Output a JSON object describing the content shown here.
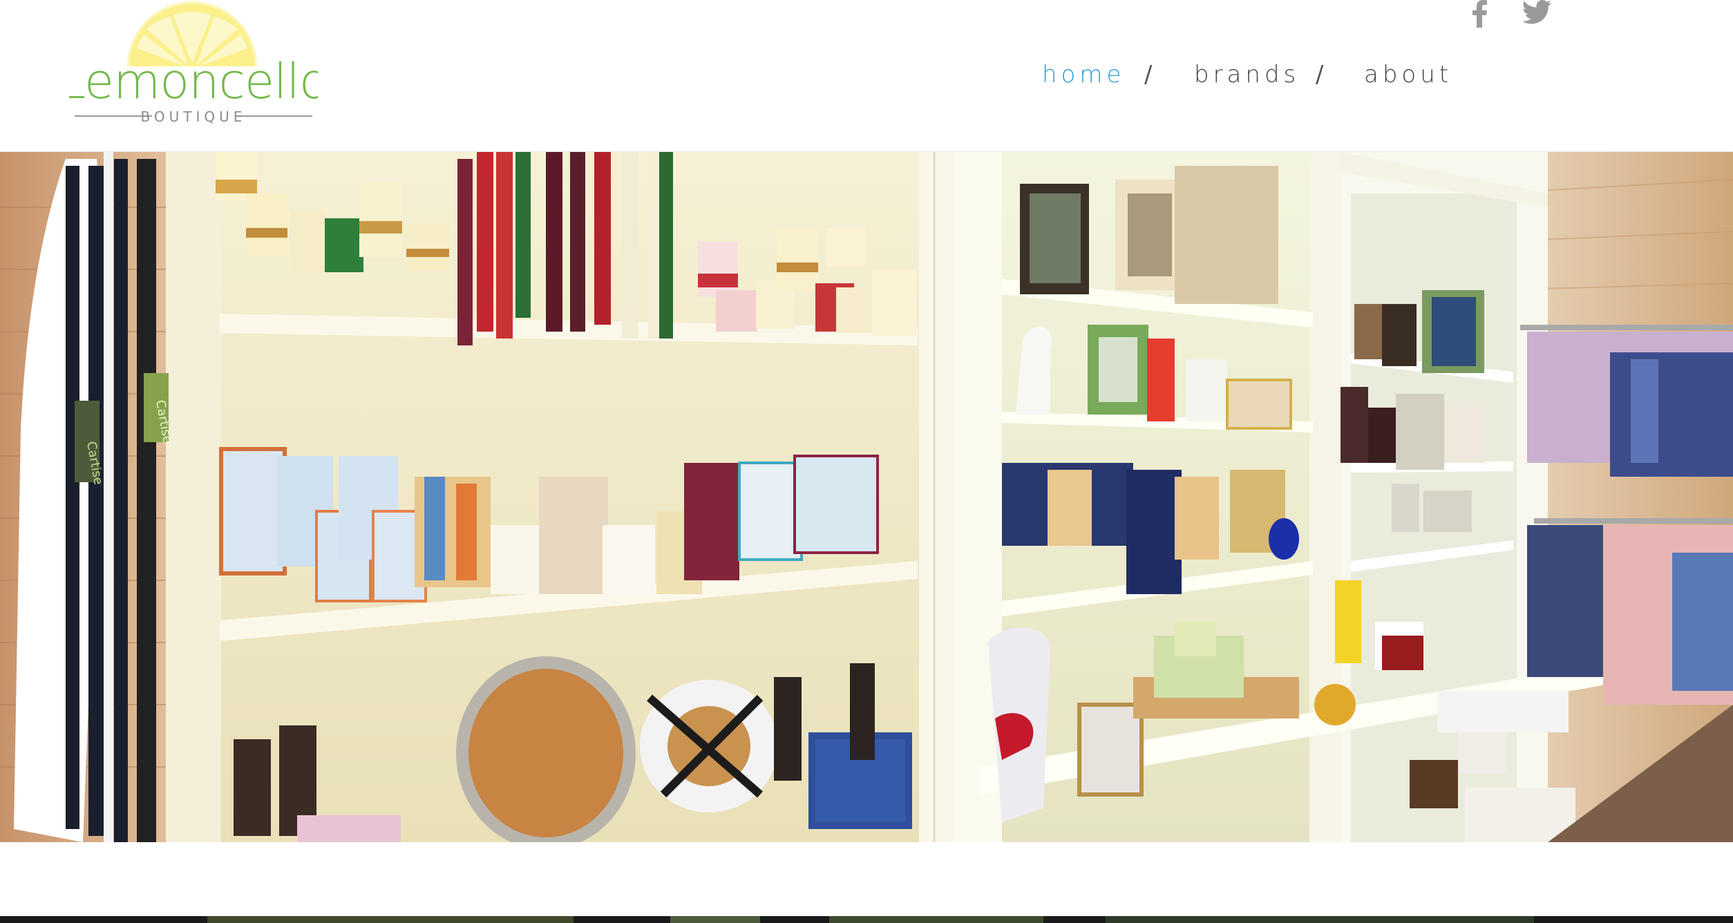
{
  "brand": {
    "name": "Lemoncello",
    "tagline": "BOUTIQUE",
    "colors": {
      "lemon": "#fbf08a",
      "green": "#74b84a",
      "tagline": "#8c8c8c"
    }
  },
  "social": {
    "facebook_icon": "facebook-icon",
    "twitter_icon": "twitter-icon",
    "icon_color": "#9a9a9a"
  },
  "nav": {
    "items": [
      {
        "label": "home",
        "active": true
      },
      {
        "label": "brands",
        "active": false
      },
      {
        "label": "about",
        "active": false
      }
    ],
    "separator": "/",
    "active_color": "#2b9ed8",
    "color": "#444444"
  },
  "hero": {
    "image_subject": "boutique shelves with candles, frames, gifts and clothing",
    "hang_tags": [
      "Cartise",
      "Cartise"
    ]
  }
}
